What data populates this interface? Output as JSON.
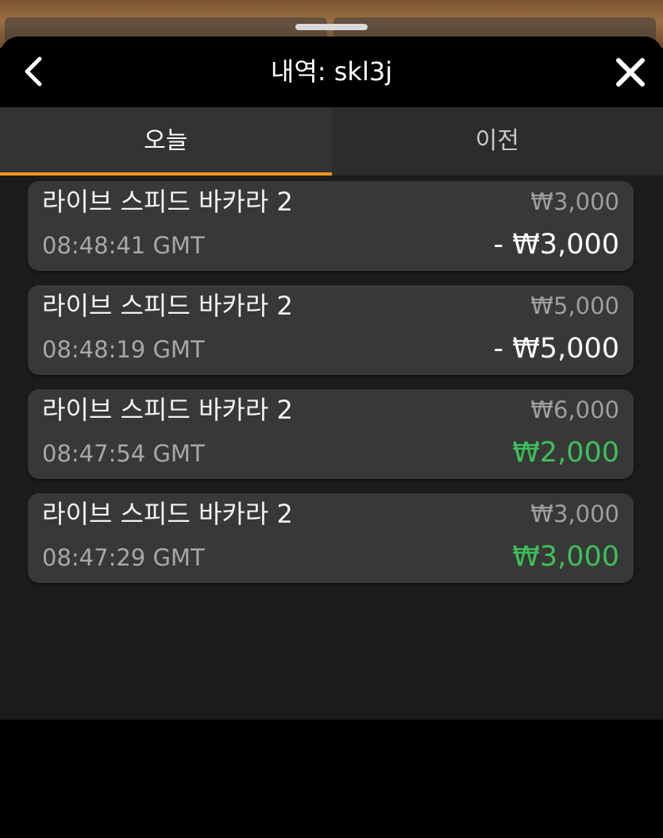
{
  "header": {
    "title": "내역: skl3j",
    "back_icon": "chevron-left-icon",
    "close_icon": "close-icon"
  },
  "tabs": [
    {
      "label": "오늘",
      "active": true
    },
    {
      "label": "이전",
      "active": false
    }
  ],
  "colors": {
    "accent": "#f29422",
    "loss": "#ffffff",
    "win": "#3fbf5a"
  },
  "history": [
    {
      "game": "라이브 스피드 바카라 2",
      "time": "08:48:41 GMT",
      "bet": "₩3,000",
      "result": "- ₩3,000",
      "outcome": "loss"
    },
    {
      "game": "라이브 스피드 바카라 2",
      "time": "08:48:19 GMT",
      "bet": "₩5,000",
      "result": "- ₩5,000",
      "outcome": "loss"
    },
    {
      "game": "라이브 스피드 바카라 2",
      "time": "08:47:54 GMT",
      "bet": "₩6,000",
      "result": "₩2,000",
      "outcome": "win"
    },
    {
      "game": "라이브 스피드 바카라 2",
      "time": "08:47:29 GMT",
      "bet": "₩3,000",
      "result": "₩3,000",
      "outcome": "win"
    }
  ]
}
